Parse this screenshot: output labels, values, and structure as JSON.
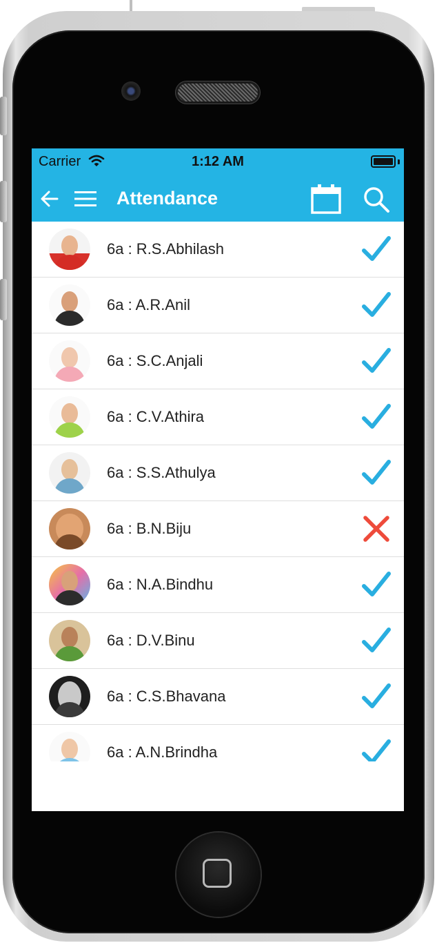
{
  "status_bar": {
    "carrier": "Carrier",
    "time": "1:12 AM"
  },
  "app_bar": {
    "title": "Attendance"
  },
  "colors": {
    "primary": "#24b4e4",
    "present": "#29aee0",
    "absent": "#ee4b3b"
  },
  "icons": {
    "back": "arrow-left-icon",
    "menu": "hamburger-menu-icon",
    "calendar": "calendar-icon",
    "search": "search-icon",
    "present": "checkmark-icon",
    "absent": "cross-icon"
  },
  "students": [
    {
      "name": "6a : R.S.Abhilash",
      "status": "present"
    },
    {
      "name": "6a : A.R.Anil",
      "status": "present"
    },
    {
      "name": "6a : S.C.Anjali",
      "status": "present"
    },
    {
      "name": "6a : C.V.Athira",
      "status": "present"
    },
    {
      "name": "6a : S.S.Athulya",
      "status": "present"
    },
    {
      "name": "6a : B.N.Biju",
      "status": "absent"
    },
    {
      "name": "6a : N.A.Bindhu",
      "status": "present"
    },
    {
      "name": "6a : D.V.Binu",
      "status": "present"
    },
    {
      "name": "6a : C.S.Bhavana",
      "status": "present"
    },
    {
      "name": "6a : A.N.Brindha",
      "status": "present"
    }
  ]
}
